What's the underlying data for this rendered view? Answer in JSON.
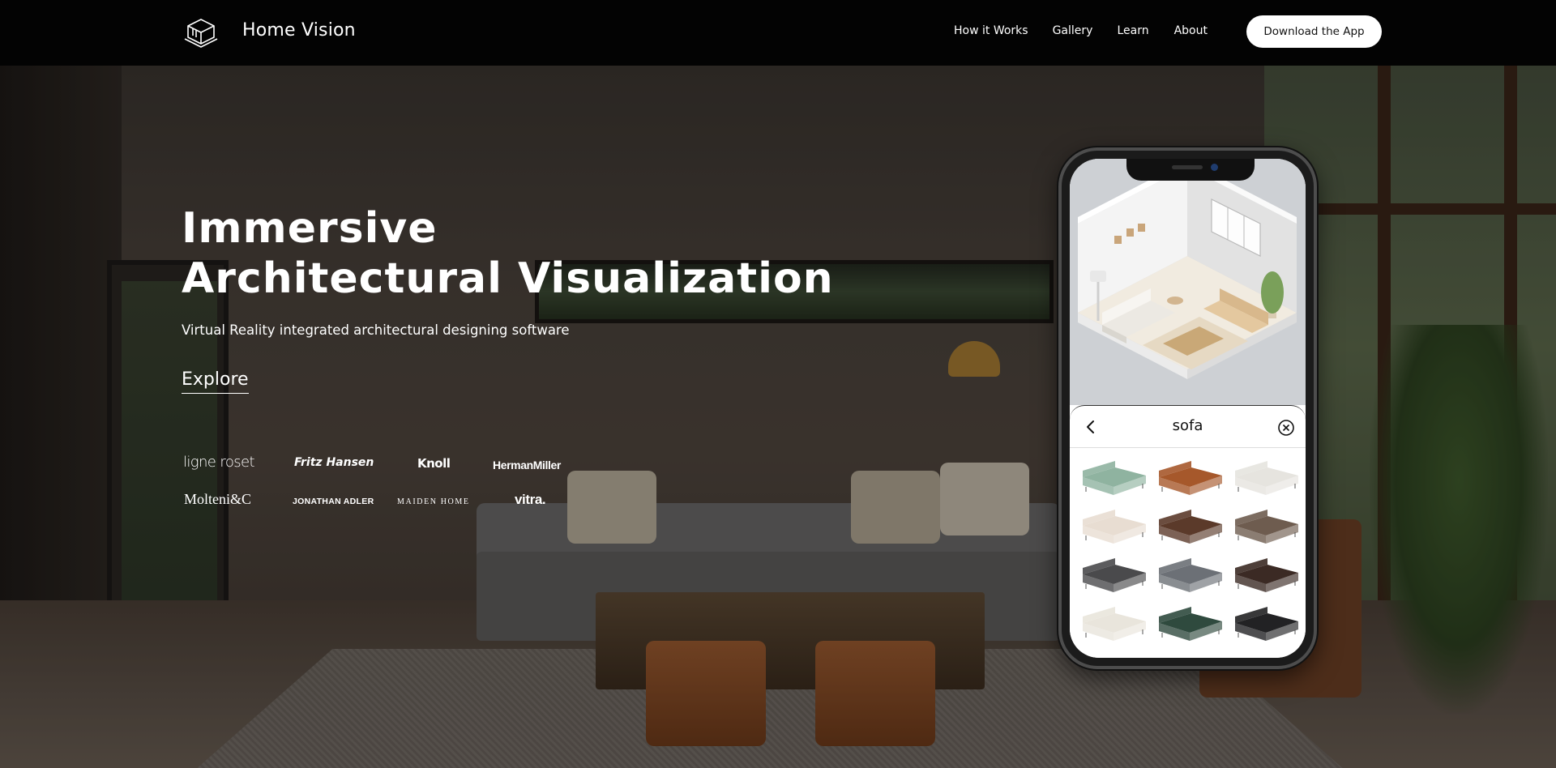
{
  "navbar": {
    "brand": "Home Vision",
    "links": [
      "How it Works",
      "Gallery",
      "Learn",
      "About"
    ],
    "cta": "Download the App"
  },
  "hero": {
    "title_line1": "Immersive",
    "title_line2": "Architectural Visualization",
    "subtitle": "Virtual Reality integrated architectural designing software",
    "explore": "Explore"
  },
  "brands": [
    "ligne roset",
    "Fritz Hansen",
    "Knoll",
    "HermanMiller",
    "Molteni&C",
    "JONATHAN ADLER",
    "MAIDEN HOME",
    "vitra."
  ],
  "phone": {
    "search_query": "sofa",
    "results": [
      {
        "name": "green-sectional",
        "color": "#8fb3a0"
      },
      {
        "name": "cognac-lounger",
        "color": "#a6582b"
      },
      {
        "name": "white-long-sofa",
        "color": "#e6e4df"
      },
      {
        "name": "cream-curved-sofa",
        "color": "#e8ddd2"
      },
      {
        "name": "brown-chaise-sofa",
        "color": "#5b3a2a"
      },
      {
        "name": "taupe-sofa",
        "color": "#6e5c4f"
      },
      {
        "name": "charcoal-sofa",
        "color": "#4a4a4c"
      },
      {
        "name": "grey-tufted-sofa",
        "color": "#6c7076"
      },
      {
        "name": "dark-brown-sofa",
        "color": "#3b2a24"
      },
      {
        "name": "ivory-sofa",
        "color": "#e9e5dc"
      },
      {
        "name": "forest-green-sofa",
        "color": "#2f4a3e"
      },
      {
        "name": "black-loveseat",
        "color": "#222224"
      }
    ]
  },
  "colors": {
    "navbar_bg": "#030303",
    "cta_bg": "#ffffff",
    "text": "#ffffff"
  }
}
